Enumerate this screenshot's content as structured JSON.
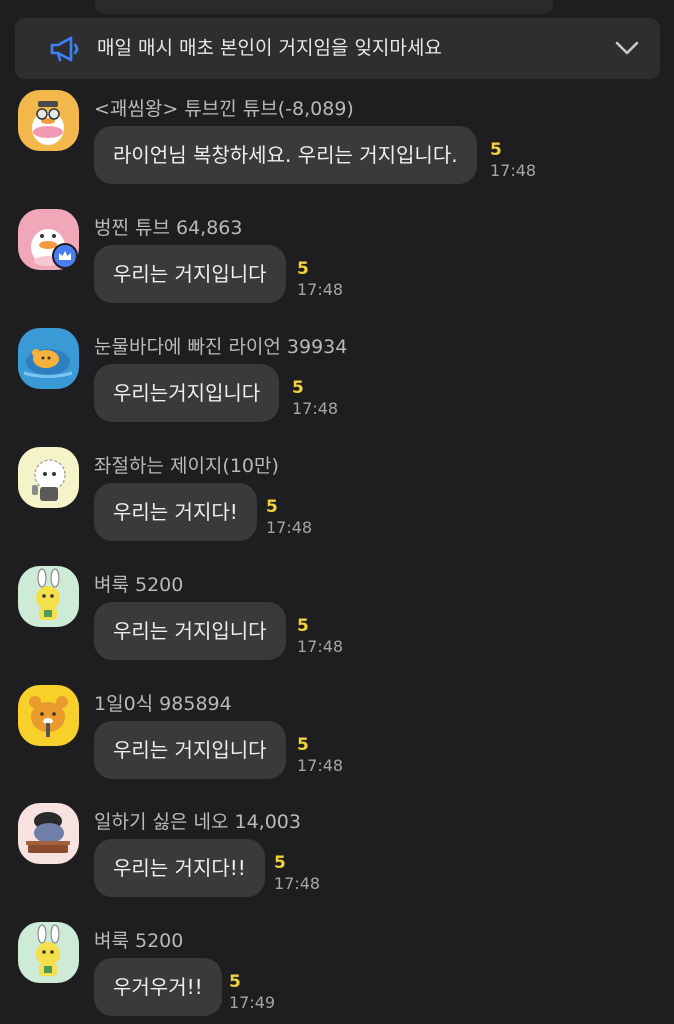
{
  "notice": {
    "text": "매일 매시 매초 본인이 거지임을 잊지마세요",
    "icon": "megaphone-icon",
    "expand_icon": "chevron-down-icon"
  },
  "colors": {
    "background": "#1e1e20",
    "bubble": "#3a3a3d",
    "unread_count": "#f0d23c",
    "notice_bg": "#2e2e31"
  },
  "messages": [
    {
      "sender": "<괘씸왕> 튜브낀 튜브(-8,089)",
      "text": "라이언님 복창하세요. 우리는 거지입니다.",
      "count": "5",
      "time": "17:48",
      "avatar": "tube-duck-avatar"
    },
    {
      "sender": "벙찐 튜브 64,863",
      "text": "우리는 거지입니다",
      "count": "5",
      "time": "17:48",
      "avatar": "tube-duck-avatar",
      "crown": true
    },
    {
      "sender": "눈물바다에 빠진 라이언 39934",
      "text": "우리는거지입니다",
      "count": "5",
      "time": "17:48",
      "avatar": "ryan-avatar"
    },
    {
      "sender": "좌절하는 제이지(10만)",
      "text": "우리는 거지다!",
      "count": "5",
      "time": "17:48",
      "avatar": "jay-g-avatar"
    },
    {
      "sender": "벼룩 5200",
      "text": "우리는 거지입니다",
      "count": "5",
      "time": "17:48",
      "avatar": "muzi-avatar"
    },
    {
      "sender": "1일0식 985894",
      "text": "우리는 거지입니다",
      "count": "5",
      "time": "17:48",
      "avatar": "ryan-avatar"
    },
    {
      "sender": "일하기 싫은 네오 14,003",
      "text": "우리는 거지다!!",
      "count": "5",
      "time": "17:48",
      "avatar": "neo-avatar"
    },
    {
      "sender": "벼룩 5200",
      "text": "우거우거!!",
      "count": "5",
      "time": "17:49",
      "avatar": "muzi-avatar"
    }
  ]
}
